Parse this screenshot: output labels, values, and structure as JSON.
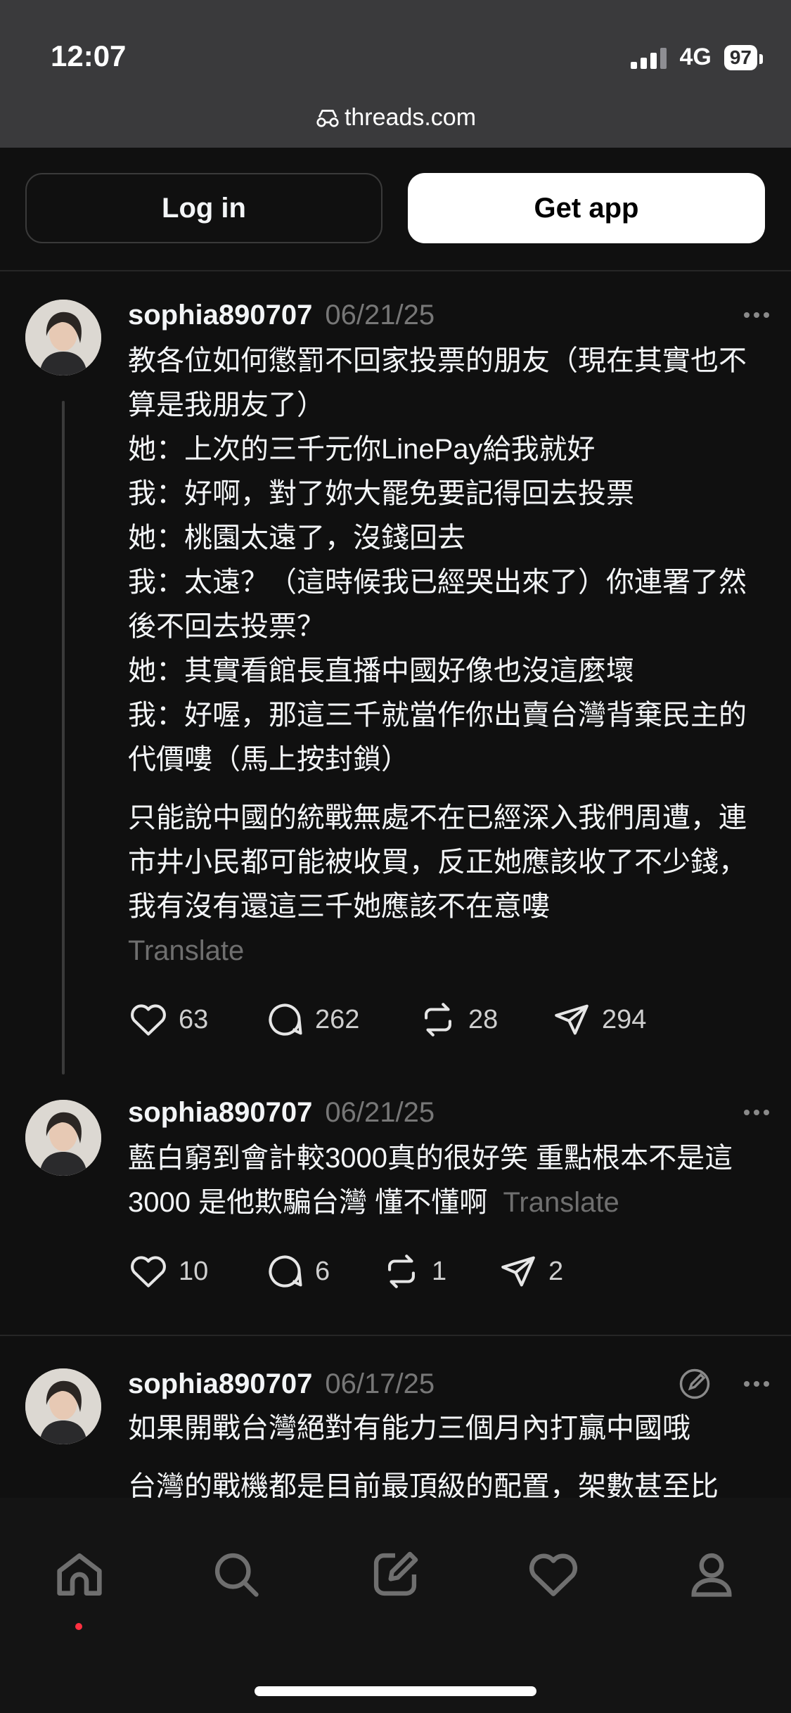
{
  "status_bar": {
    "time": "12:07",
    "network": "4G",
    "battery": "97"
  },
  "url_bar": {
    "domain": "threads.com"
  },
  "auth": {
    "login_label": "Log in",
    "get_app_label": "Get app"
  },
  "posts": [
    {
      "username": "sophia890707",
      "date": "06/21/25",
      "text": "教各位如何懲罰不回家投票的朋友（現在其實也不算是我朋友了）\n她：上次的三千元你LinePay給我就好\n我：好啊，對了妳大罷免要記得回去投票\n她：桃園太遠了，沒錢回去\n我：太遠？（這時候我已經哭出來了）你連署了然後不回去投票？\n她：其實看館長直播中國好像也沒這麼壞\n我：好喔，那這三千就當作你出賣台灣背棄民主的代價嘍（馬上按封鎖）",
      "text2": "只能說中國的統戰無處不在已經深入我們周遭，連市井小民都可能被收買，反正她應該收了不少錢，我有沒有還這三千她應該不在意嘍",
      "translate": "Translate",
      "likes": "63",
      "replies": "262",
      "reposts": "28",
      "shares": "294"
    },
    {
      "username": "sophia890707",
      "date": "06/21/25",
      "text": "藍白窮到會計較3000真的很好笑 重點根本不是這3000 是他欺騙台灣 懂不懂啊",
      "translate": "Translate",
      "likes": "10",
      "replies": "6",
      "reposts": "1",
      "shares": "2"
    },
    {
      "username": "sophia890707",
      "date": "06/17/25",
      "text": "如果開戰台灣絕對有能力三個月內打贏中國哦",
      "text_cut": "台灣的戰機都是目前最頂級的配置，架數甚至比"
    }
  ],
  "icons": {
    "like": "heart-icon",
    "reply": "comment-icon",
    "repost": "repost-icon",
    "share": "send-icon",
    "nav": [
      "home-icon",
      "search-icon",
      "compose-icon",
      "activity-heart-icon",
      "profile-icon"
    ]
  },
  "colors": {
    "background": "#101010",
    "notification_dot": "#ff3040"
  }
}
